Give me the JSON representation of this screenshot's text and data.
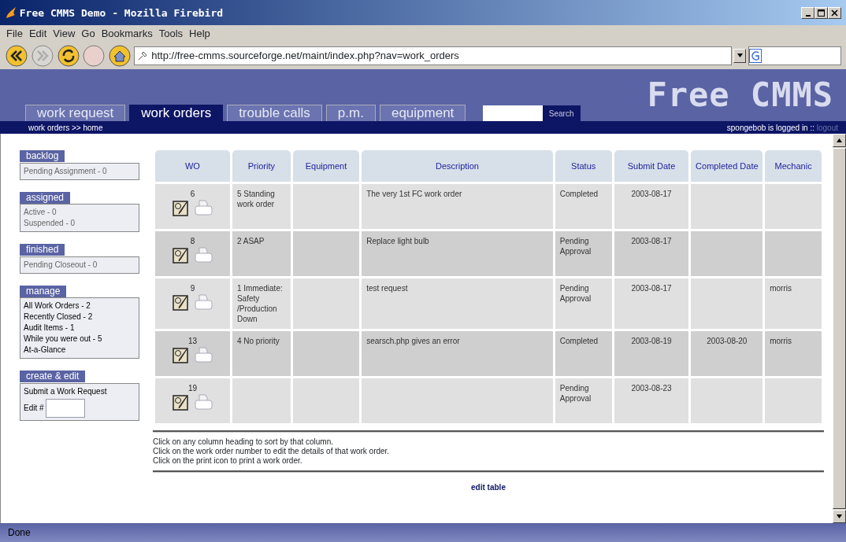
{
  "window": {
    "title": "Free CMMS Demo - Mozilla Firebird"
  },
  "menu": [
    "File",
    "Edit",
    "View",
    "Go",
    "Bookmarks",
    "Tools",
    "Help"
  ],
  "toolbar": {
    "address": "http://free-cmms.sourceforge.net/maint/index.php?nav=work_orders"
  },
  "header": {
    "logo": "Free CMMS",
    "search_button": "Search",
    "breadcrumb": "work orders >> home",
    "user_status": "spongebob is logged in ::",
    "logout": "logout"
  },
  "tabs": [
    {
      "label": "work request",
      "selected": false
    },
    {
      "label": "work orders",
      "selected": true
    },
    {
      "label": "trouble calls",
      "selected": false
    },
    {
      "label": "p.m.",
      "selected": false
    },
    {
      "label": "equipment",
      "selected": false
    }
  ],
  "sidebar": [
    {
      "title": "backlog",
      "kind": "stat",
      "items": [
        "Pending Assignment - 0"
      ]
    },
    {
      "title": "assigned",
      "kind": "stat",
      "items": [
        "Active - 0",
        "Suspended - 0"
      ]
    },
    {
      "title": "finished",
      "kind": "stat",
      "items": [
        "Pending Closeout - 0"
      ]
    },
    {
      "title": "manage",
      "kind": "link",
      "items": [
        "All Work Orders - 2",
        "Recently Closed - 2",
        "Audit Items - 1",
        "While you were out - 5",
        "At-a-Glance"
      ]
    },
    {
      "title": "create & edit",
      "kind": "form",
      "items": [
        "Submit a Work Request"
      ],
      "field_label": "Edit #"
    }
  ],
  "table": {
    "columns": [
      "WO",
      "Priority",
      "Equipment",
      "Description",
      "Status",
      "Submit Date",
      "Completed Date",
      "Mechanic"
    ],
    "rows": [
      {
        "wo": "6",
        "priority": "5 Standing work order",
        "description": "The very 1st FC work order",
        "status": "Completed",
        "submit_date": "2003-08-17"
      },
      {
        "wo": "8",
        "priority": "2 ASAP",
        "description": "Replace light bulb",
        "status": "Pending Approval",
        "submit_date": "2003-08-17"
      },
      {
        "wo": "9",
        "priority": "1 Immediate: Safety /Production Down",
        "description": "test request",
        "status": "Pending Approval",
        "submit_date": "2003-08-17",
        "mechanic": "morris"
      },
      {
        "wo": "13",
        "priority": "4 No priority",
        "description": "searsch.php gives an error",
        "status": "Completed",
        "submit_date": "2003-08-19",
        "completed_date": "2003-08-20",
        "mechanic": "morris"
      },
      {
        "wo": "19",
        "status": "Pending Approval",
        "submit_date": "2003-08-23"
      }
    ]
  },
  "help": [
    "Click on any column heading to sort by that column.",
    "Click on the work order number to edit the details of that work order.",
    "Click on the print icon to print a work order."
  ],
  "edit_link": "edit table",
  "status_bar": "Done"
}
